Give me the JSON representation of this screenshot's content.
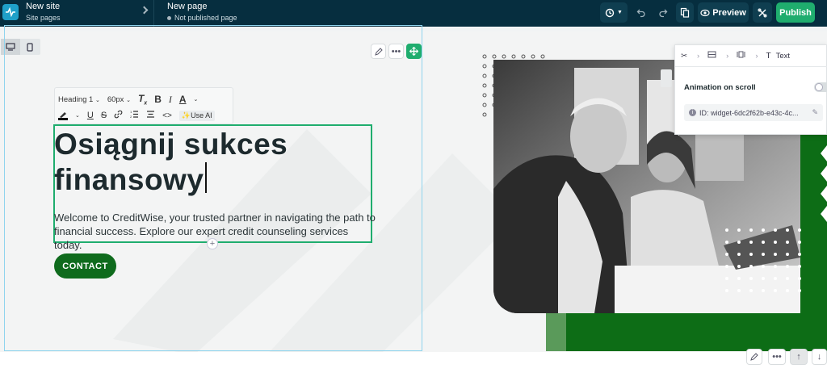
{
  "header": {
    "site_title": "New site",
    "site_subtitle": "Site pages",
    "page_title": "New page",
    "page_status": "Not published page",
    "preview_label": "Preview",
    "publish_label": "Publish"
  },
  "format_toolbar": {
    "heading_select": "Heading 1",
    "size_select": "60px",
    "ai_label": "Use AI"
  },
  "content": {
    "heading_line1": "Osiągnij sukces",
    "heading_line2": "finansowy",
    "body": "Welcome to CreditWise, your trusted partner in navigating the path to financial success. Explore our expert credit counseling services today.",
    "cta_label": "CONTACT"
  },
  "panel": {
    "breadcrumb_last": "Text",
    "animation_label": "Animation on scroll",
    "widget_id": "ID: widget-6dc2f62b-e43c-4c..."
  },
  "colors": {
    "topbar": "#062e3f",
    "accent": "#1fad6e",
    "cta": "#0f6b1d",
    "selection": "#8fd4ee"
  }
}
